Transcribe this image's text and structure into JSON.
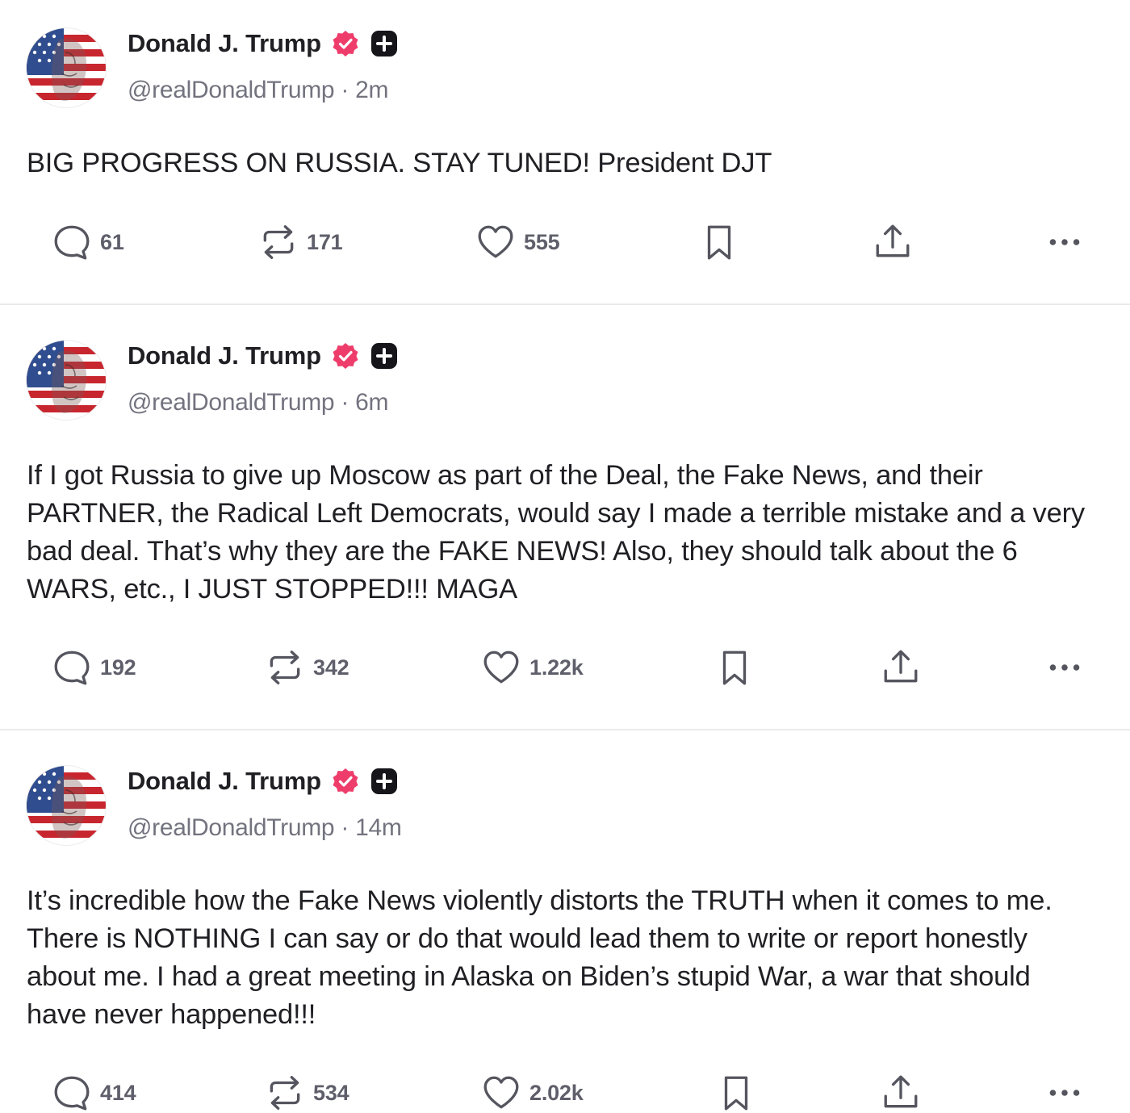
{
  "posts": [
    {
      "author": "Donald J. Trump",
      "handle": "@realDonaldTrump",
      "separator": "·",
      "time": "2m",
      "text": "BIG PROGRESS ON RUSSIA. STAY TUNED! President DJT",
      "replies": "61",
      "reposts": "171",
      "likes": "555"
    },
    {
      "author": "Donald J. Trump",
      "handle": "@realDonaldTrump",
      "separator": "·",
      "time": "6m",
      "text": "If I got Russia to give up Moscow as part of the Deal, the Fake News, and their PARTNER, the Radical Left Democrats, would say I made a terrible mistake and a very bad deal. That’s why they are the FAKE NEWS! Also, they should talk about the 6 WARS, etc., I JUST STOPPED!!! MAGA",
      "replies": "192",
      "reposts": "342",
      "likes": "1.22k"
    },
    {
      "author": "Donald J. Trump",
      "handle": "@realDonaldTrump",
      "separator": "·",
      "time": "14m",
      "text": "It’s incredible how the Fake News violently distorts the TRUTH when it comes to me. There is NOTHING I can say or do that would lead them to write or report honestly about me. I had a great meeting in Alaska on Biden’s stupid War, a war that should have never happened!!!",
      "replies": "414",
      "reposts": "534",
      "likes": "2.02k"
    }
  ],
  "icons": {
    "verified": "verified-badge-icon",
    "plus": "plus-badge-icon",
    "reply": "reply-icon",
    "repost": "repost-icon",
    "like": "heart-icon",
    "bookmark": "bookmark-icon",
    "share": "share-icon",
    "more": "more-icon"
  },
  "colors": {
    "verified_badge": "#ee3d6b",
    "text": "#1f1f24",
    "muted": "#73737f",
    "counts": "#5f5f6b"
  }
}
